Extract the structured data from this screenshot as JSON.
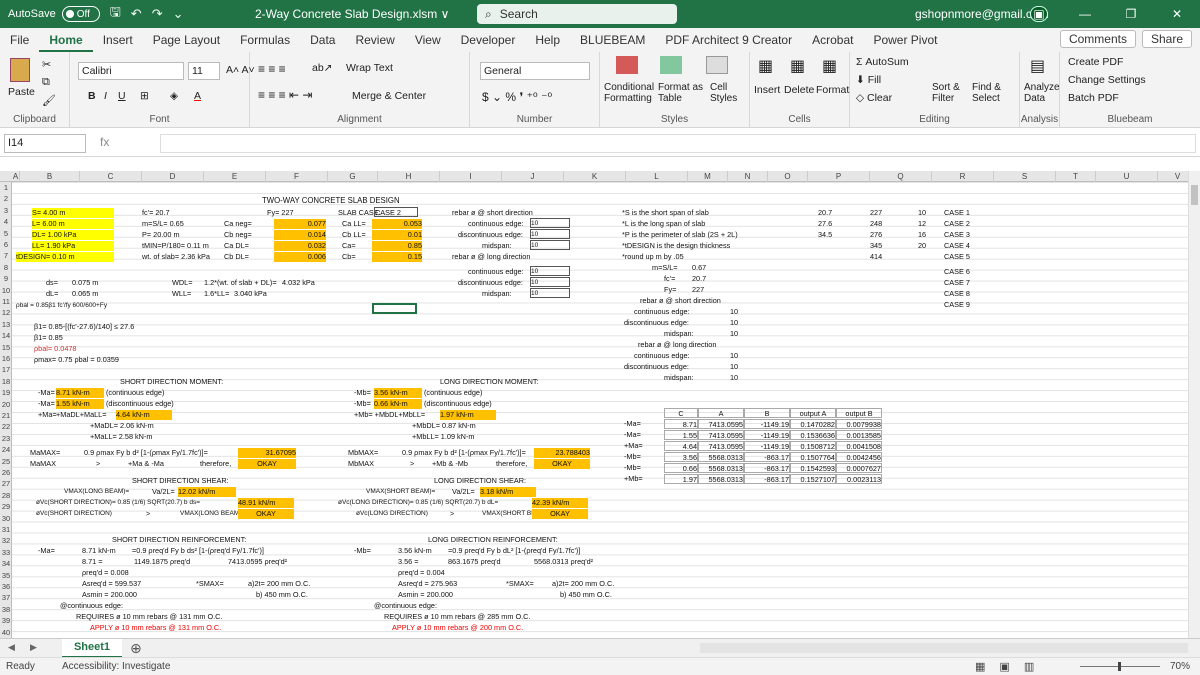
{
  "titlebar": {
    "autosave": "AutoSave",
    "autosave_state": "Off",
    "document": "2-Way Concrete Slab Design.xlsm ∨",
    "search": "Search",
    "email": "gshopnmore@gmail.com"
  },
  "tabs": [
    "File",
    "Home",
    "Insert",
    "Page Layout",
    "Formulas",
    "Data",
    "Review",
    "View",
    "Developer",
    "Help",
    "BLUEBEAM",
    "PDF Architect 9 Creator",
    "Acrobat",
    "Power Pivot"
  ],
  "tabs_right": {
    "comments": "Comments",
    "share": "Share"
  },
  "ribbon": {
    "paste": "Paste",
    "clipboard": "Clipboard",
    "font_name": "Calibri",
    "font_size": "11",
    "font_group": "Font",
    "wrap_text": "Wrap Text",
    "merge_center": "Merge & Center",
    "alignment": "Alignment",
    "number_format": "General",
    "number": "Number",
    "conditional": "Conditional Formatting",
    "format_table": "Format as Table",
    "cell_styles": "Cell Styles",
    "styles": "Styles",
    "insert": "Insert",
    "delete": "Delete",
    "format": "Format",
    "cells": "Cells",
    "autosum": "AutoSum",
    "fill": "Fill",
    "clear": "Clear",
    "sort_filter": "Sort & Filter",
    "find_select": "Find & Select",
    "editing": "Editing",
    "analyze": "Analyze Data",
    "analysis": "Analysis",
    "create_pdf": "Create PDF",
    "change_settings": "Change Settings",
    "batch_pdf": "Batch PDF",
    "bluebeam": "Bluebeam"
  },
  "namebox": "I14",
  "fx": "fx",
  "columns": [
    "A",
    "B",
    "C",
    "D",
    "E",
    "F",
    "G",
    "H",
    "I",
    "J",
    "K",
    "L",
    "M",
    "N",
    "O",
    "P",
    "Q",
    "R",
    "S",
    "T",
    "U",
    "V",
    "W",
    "X",
    "Y",
    "Z"
  ],
  "rows": [
    "1",
    "2",
    "3",
    "4",
    "5",
    "6",
    "7",
    "8",
    "9",
    "10",
    "11",
    "12",
    "13",
    "14",
    "15",
    "16",
    "17",
    "18",
    "19",
    "20",
    "21",
    "22",
    "23",
    "24",
    "25",
    "26",
    "27",
    "28",
    "29",
    "30",
    "31",
    "32",
    "33",
    "34",
    "35",
    "36",
    "37",
    "38",
    "39",
    "40"
  ],
  "cells": {
    "title": "TWO-WAY CONCRETE SLAB DESIGN",
    "s": "S= 4.00 m",
    "l": "L= 6.00 m",
    "dl": "DL= 1.00 kPa",
    "ll": "LL= 1.90 kPa",
    "tdesign": "tDESIGN= 0.10 m",
    "fc": "fc'= 20.7",
    "ms": "m=S/L= 0.65",
    "p": "P= 20.00 m",
    "tmin": "tMIN=P/180= 0.11 m",
    "wt": "wt. of slab= 2.36 kPa",
    "fy": "Fy= 227",
    "ca_neg": "Ca neg=",
    "cb_neg": "Cb neg=",
    "ca_dl": "Ca DL=",
    "cb_dl": "Cb DL=",
    "ca_neg_v": "0.077",
    "cb_neg_v": "0.014",
    "ca_dl_v": "0.032",
    "cb_dl_v": "0.006",
    "slabcase": "SLAB CASE:",
    "slabcase_v": "CASE 2",
    "ca_ll": "Ca LL=",
    "cb_ll": "Cb LL=",
    "ca": "Ca=",
    "cb": "Cb=",
    "ca_ll_v": "0.053",
    "cb_ll_v": "0.01",
    "ca_v": "0.85",
    "cb_v": "0.15",
    "rebar_short": "rebar ø @ short direction",
    "cont_edge": "continuous edge:",
    "discont_edge": "discontinuous edge:",
    "midspan": "midspan:",
    "rebar_long": "rebar ø @ long direction",
    "ten": "10",
    "note1": "*S is the short span of slab",
    "note2": "*L is the long span of slab",
    "note3": "*P is the perimeter of slab (2S + 2L)",
    "note4": "*tDESIGN is the design thickness",
    "note5": "*round up m by .05",
    "r1": "20.7",
    "r2": "27.6",
    "r3": "34.5",
    "s1": "227",
    "s2": "248",
    "s3": "276",
    "s4": "345",
    "s5": "414",
    "t1": "10",
    "t2": "12",
    "t3": "16",
    "t4": "20",
    "case1": "CASE 1",
    "case2": "CASE 2",
    "case3": "CASE 3",
    "case4": "CASE 4",
    "case5": "CASE 5",
    "case6": "CASE 6",
    "case7": "CASE 7",
    "case8": "CASE 8",
    "case9": "CASE 9",
    "ds": "ds=",
    "dl2": "dL=",
    "ds_v": "0.075 m",
    "dl_v": "0.065 m",
    "wdl": "WDL=",
    "wll": "WLL=",
    "wdl_f": "1.2*(wt. of slab + DL)=",
    "wll_f": "1.6*LL=",
    "wdl_v": "4.032 kPa",
    "wll_v": "3.040 kPa",
    "pbal": "ρbal = 0.85β1 fc'/fy 600/600+Fy",
    "b1f": "β1= 0.85-[(fc'-27.6)/140] ≤ 27.6",
    "b1": "β1= 0.85",
    "pbal_v": "ρbal= 0.0478",
    "pmax": "ρmax= 0.75 ρbal = 0.0359",
    "m_sl": "m=S/L=",
    "m_sl_v": "0.67",
    "fc2": "fc'=",
    "fc2_v": "20.7",
    "fy2": "Fy=",
    "fy2_v": "227",
    "short_moment": "SHORT DIRECTION MOMENT:",
    "long_moment": "LONG DIRECTION MOMENT:",
    "ma1": "-Ma=",
    "ma1_v": "8.71 kN-m",
    "ma1_t": "(continuous edge)",
    "ma2": "-Ma=",
    "ma2_v": "1.55 kN-m",
    "ma2_t": "(discontinuous edge)",
    "ma3": "+Ma=",
    "ma3_f": "+MaDL+MaLL=",
    "ma3_v": "4.64 kN-m",
    "ma4": "+MaDL= 2.06 kN-m",
    "ma5": "+MaLL= 2.58 kN-m",
    "mamax": "MaMAX=",
    "mamax_f": "0.9 ρmax Fy b d² [1-(ρmax Fy/1.7fc')]=",
    "mamax_v": "31.67095",
    "mamax2": "MaMAX",
    "gt": ">",
    "mamax2_f": "+Ma & -Ma",
    "therefore": "therefore,",
    "okay": "OKAY",
    "mb1": "-Mb=",
    "mb1_v": "3.56 kN-m",
    "mb1_t": "(continuous edge)",
    "mb2": "-Mb=",
    "mb2_v": "0.66 kN-m",
    "mb2_t": "(discontinuous edge)",
    "mb3": "+Mb= +MbDL+MbLL=",
    "mb3_v": "1.97 kN-m",
    "mb4": "+MbDL= 0.87 kN-m",
    "mb5": "+MbLL= 1.09 kN-m",
    "mbmax": "MbMAX=",
    "mbmax_f": "0.9 ρmax Fy b d² [1-(ρmax Fy/1.7fc')]=",
    "mbmax_v": "23.788403",
    "mbmax2": "MbMAX",
    "mbmax2_f": "+Mb & -Mb",
    "tbl_h": [
      "C",
      "A",
      "B",
      "output A",
      "output B"
    ],
    "tbl": [
      [
        "-Ma=",
        "8.71",
        "7413.0595",
        "-1149.19",
        "0.1470282",
        "0.0079938"
      ],
      [
        "-Ma=",
        "1.55",
        "7413.0595",
        "-1149.19",
        "0.1536636",
        "0.0013585"
      ],
      [
        "+Ma=",
        "4.64",
        "7413.0595",
        "-1149.19",
        "0.1508712",
        "0.0041508"
      ],
      [
        "-Mb=",
        "3.56",
        "5568.0313",
        "-863.17",
        "0.1507764",
        "0.0042456"
      ],
      [
        "-Mb=",
        "0.66",
        "5568.0313",
        "-863.17",
        "0.1542593",
        "0.0007627"
      ],
      [
        "+Mb=",
        "1.97",
        "5568.0313",
        "-863.17",
        "0.1527107",
        "0.0023113"
      ]
    ],
    "short_shear": "SHORT DIRECTION SHEAR:",
    "long_shear": "LONG DIRECTION SHEAR:",
    "vmax_l": "VMAX(LONG BEAM)=",
    "va2": "Va/2L=",
    "va2_v": "12.02 kN/m",
    "vc_s": "øVc(SHORT DIRECTION)= 0.85 (1/6) SQRT(20.7) b ds=",
    "vc_s_v": "48.91 kN/m",
    "vc_s2": "øVc(SHORT DIRECTION)",
    "vmax_l2": "VMAX(LONG BEAM)",
    "vmax_s": "VMAX(SHORT BEAM)=",
    "vb2": "Va/2L=",
    "vb2_v": "3.18 kN/m",
    "vc_l": "øVc(LONG DIRECTION)= 0.85 (1/6) SQRT(20.7) b dL=",
    "vc_l_v": "42.39 kN/m",
    "vc_l2": "øVc(LONG DIRECTION)",
    "vmax_s2": "VMAX(SHORT BEAM)",
    "short_reinf": "SHORT DIRECTION REINFORCEMENT:",
    "long_reinf": "LONG DIRECTION REINFORCEMENT:",
    "sr_ma": "-Ma=",
    "sr_ma_v": "8.71 kN-m",
    "sr_f": "=0.9 ρreq'd Fy b ds² [1-(ρreq'd Fy/1.7fc')]",
    "sr_871": "8.71 =",
    "sr_a": "1149.1875 ρreq'd",
    "sr_b": "7413.0595 ρreq'd²",
    "sr_p": "ρreq'd = 0.008",
    "sr_as": "Asreq'd = 599.537",
    "sr_asmin": "Asmin = 200.000",
    "smax": "*SMAX=",
    "sr_a2": "a)2t= 200 mm O.C.",
    "sr_b2": "b) 450 mm O.C.",
    "cont": "@continuous edge:",
    "sr_req": "REQUIRES ø 10 mm rebars @ 131 mm O.C.",
    "sr_apply": "APPLY ø 10 mm rebars @ 131 mm O.C.",
    "lr_mb": "-Mb=",
    "lr_mb_v": "3.56 kN-m",
    "lr_f": "=0.9 ρreq'd Fy b dL² [1-(ρreq'd Fy/1.7fc')]",
    "lr_356": "3.56 =",
    "lr_a": "863.1675 ρreq'd",
    "lr_b": "5568.0313 ρreq'd²",
    "lr_p": "ρreq'd = 0.004",
    "lr_as": "Asreq'd = 275.963",
    "lr_asmin": "Asmin = 200.000",
    "lr_a2": "a)2t= 200 mm O.C.",
    "lr_b2": "b) 450 mm O.C.",
    "lr_req": "REQUIRES ø 10 mm rebars @ 285 mm O.C.",
    "lr_apply": "APPLY ø 10 mm rebars @ 200 mm O.C."
  },
  "sheet_tab": "Sheet1",
  "status": {
    "ready": "Ready",
    "accessibility": "Accessibility: Investigate",
    "zoom": "70%"
  }
}
